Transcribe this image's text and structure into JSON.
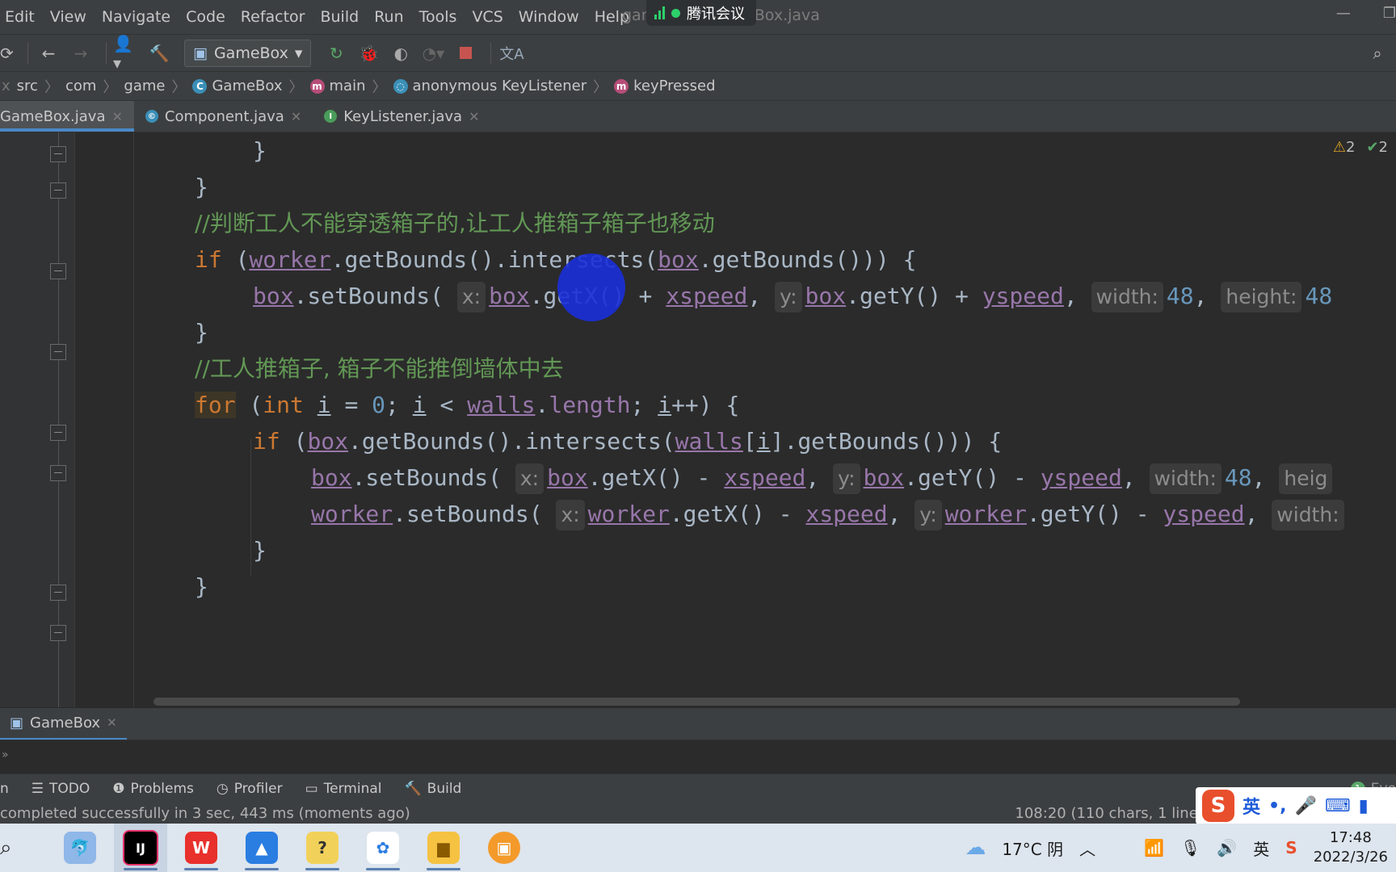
{
  "menu": [
    "Edit",
    "View",
    "Navigate",
    "Code",
    "Refactor",
    "Build",
    "Run",
    "Tools",
    "VCS",
    "Window",
    "Help"
  ],
  "window_title": "gamebox - GameBox.java",
  "meeting_label": "腾讯会议",
  "toolbar": {
    "run_config": "GameBox"
  },
  "breadcrumb": [
    "src",
    "com",
    "game",
    "GameBox",
    "main",
    "anonymous KeyListener",
    "keyPressed"
  ],
  "tabs": [
    {
      "label": "GameBox.java",
      "active": true
    },
    {
      "label": "Component.java",
      "active": false
    },
    {
      "label": "KeyListener.java",
      "active": false
    }
  ],
  "inspections": {
    "warnings": "2",
    "ok": "2"
  },
  "code": {
    "l1": "}",
    "l2": "}",
    "c1": "//判断工人不能穿透箱子的,让工人推箱子箱子也移动",
    "c2": "//工人推箱子, 箱子不能推倒墙体中去",
    "if_kw": "if",
    "for_kw": "for",
    "int_kw": "int",
    "worker": "worker",
    "box": "box",
    "walls": "walls",
    "xspeed": "xspeed",
    "yspeed": "yspeed",
    "length": "length",
    "hint_x": "x:",
    "hint_y": "y:",
    "hint_w": "width:",
    "hint_h": "height:",
    "hint_heig": "heig",
    "hint_width_cut": "width:",
    "n48": "48",
    "n0": "0",
    "n48b": "48",
    "n48c": "48",
    "n48d": "48"
  },
  "run_tab": "GameBox",
  "toolwindows": [
    "TODO",
    "Problems",
    "Profiler",
    "Terminal",
    "Build"
  ],
  "status": {
    "left": "completed successfully in 3 sec, 443 ms (moments ago)",
    "right": "108:20 (110 chars, 1 line bre"
  },
  "event_log": "Eve",
  "ime": {
    "lang": "英"
  },
  "taskbar": {
    "weather": "17°C  阴",
    "ime_lang": "英",
    "time": "17:48",
    "date": "2022/3/26"
  }
}
